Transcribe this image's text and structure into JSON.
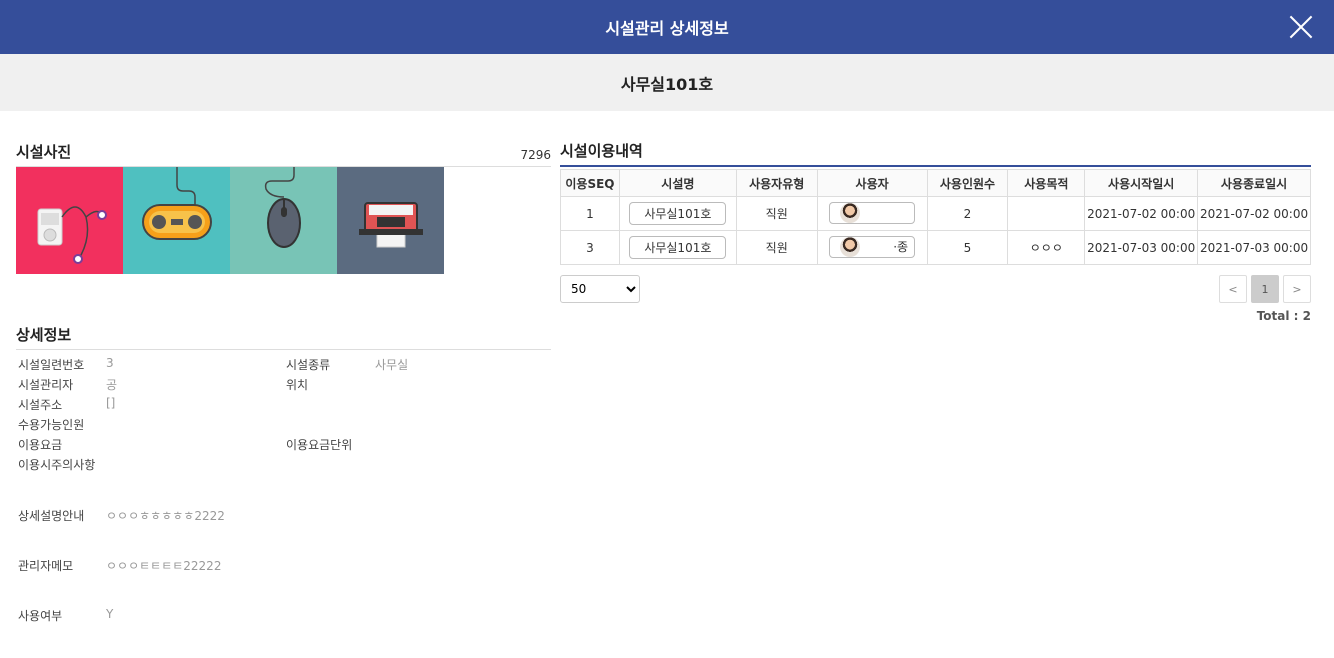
{
  "header": {
    "title": "시설관리 상세정보"
  },
  "subheader": {
    "name": "사무실101호"
  },
  "photos": {
    "title": "시설사진",
    "count": "7296",
    "items": [
      {
        "icon": "music-player-icon",
        "bg": "#f2305e"
      },
      {
        "icon": "gamepad-icon",
        "bg": "#4fc0c0"
      },
      {
        "icon": "mouse-icon",
        "bg": "#78c4b6"
      },
      {
        "icon": "instant-camera-icon",
        "bg": "#5b6b80"
      }
    ]
  },
  "detail": {
    "title": "상세정보",
    "serial_label": "시설일련번호",
    "serial_value": "3",
    "type_label": "시설종류",
    "type_value": "사무실",
    "manager_label": "시설관리자",
    "manager_value": "공",
    "location_label": "위치",
    "location_value": "",
    "address_label": "시설주소",
    "address_value": "[]",
    "capacity_label": "수용가능인원",
    "capacity_value": "",
    "fee_label": "이용요금",
    "fee_value": "",
    "fee_unit_label": "이용요금단위",
    "fee_unit_value": "",
    "notice_label": "이용시주의사항",
    "notice_value": "",
    "desc_label": "상세설명안내",
    "desc_value": "ㅇㅇㅇㅎㅎㅎㅎㅎ2222",
    "memo_label": "관리자메모",
    "memo_value": "ㅇㅇㅇㅌㅌㅌㅌ22222",
    "use_label": "사용여부",
    "use_value": "Y"
  },
  "usage": {
    "title": "시설이용내역",
    "columns": [
      "이용SEQ",
      "시설명",
      "사용자유형",
      "사용자",
      "사용인원수",
      "사용목적",
      "사용시작일시",
      "사용종료일시"
    ],
    "rows": [
      {
        "seq": "1",
        "facility": "사무실101호",
        "user_type": "직원",
        "user": "",
        "count": "2",
        "purpose": "",
        "start": "2021-07-02 00:00",
        "end": "2021-07-02 00:00"
      },
      {
        "seq": "3",
        "facility": "사무실101호",
        "user_type": "직원",
        "user": "·종",
        "count": "5",
        "purpose": "ㅇㅇㅇ",
        "start": "2021-07-03 00:00",
        "end": "2021-07-03 00:00"
      }
    ],
    "page_size": "50",
    "page_size_options": [
      "50"
    ],
    "prev": "<",
    "next": ">",
    "current_page": "1",
    "total": "Total : 2"
  }
}
